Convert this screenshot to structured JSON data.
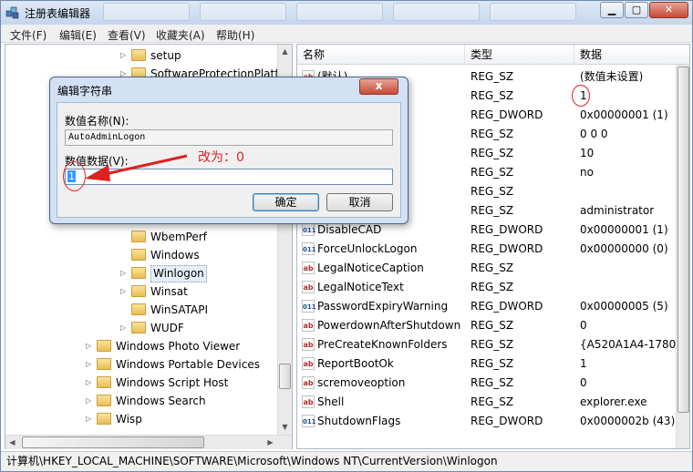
{
  "window": {
    "title": "注册表编辑器"
  },
  "menu": [
    "文件(F)",
    "编辑(E)",
    "查看(V)",
    "收藏夹(A)",
    "帮助(H)"
  ],
  "tree": {
    "items": [
      {
        "label": "setup",
        "expanded": false
      },
      {
        "label": "SoftwareProtectionPlatf",
        "expanded": false
      },
      {
        "label": "WbemPerf",
        "expanded": false
      },
      {
        "label": "Windows",
        "expanded": false
      },
      {
        "label": "Winlogon",
        "expanded": false,
        "selected": true
      },
      {
        "label": "Winsat",
        "expanded": false
      },
      {
        "label": "WinSATAPI",
        "expanded": false
      },
      {
        "label": "WUDF",
        "expanded": false
      },
      {
        "label": "Windows Photo Viewer",
        "expanded": false
      },
      {
        "label": "Windows Portable Devices",
        "expanded": false
      },
      {
        "label": "Windows Script Host",
        "expanded": false
      },
      {
        "label": "Windows Search",
        "expanded": false
      },
      {
        "label": "Wisp",
        "expanded": false
      }
    ]
  },
  "values": {
    "headers": {
      "name": "名称",
      "type": "类型",
      "data": "数据"
    },
    "rows": [
      {
        "name": "(默认)",
        "type": "REG_SZ",
        "data": "(数值未设置)",
        "kind": "sz"
      },
      {
        "name": "",
        "type": "REG_SZ",
        "data": "1",
        "kind": "sz"
      },
      {
        "name": "",
        "type": "REG_DWORD",
        "data": "0x00000001 (1)",
        "kind": "dword"
      },
      {
        "name": "",
        "type": "REG_SZ",
        "data": "0 0 0",
        "kind": "sz"
      },
      {
        "name": "unt",
        "type": "REG_SZ",
        "data": "10",
        "kind": "sz"
      },
      {
        "name": "mand",
        "type": "REG_SZ",
        "data": "no",
        "kind": "sz"
      },
      {
        "name": "",
        "type": "REG_SZ",
        "data": "",
        "kind": "sz"
      },
      {
        "name": "",
        "type": "REG_SZ",
        "data": "administrator",
        "kind": "sz"
      },
      {
        "name": "DisableCAD",
        "type": "REG_DWORD",
        "data": "0x00000001 (1)",
        "kind": "dword"
      },
      {
        "name": "ForceUnlockLogon",
        "type": "REG_DWORD",
        "data": "0x00000000 (0)",
        "kind": "dword"
      },
      {
        "name": "LegalNoticeCaption",
        "type": "REG_SZ",
        "data": "",
        "kind": "sz"
      },
      {
        "name": "LegalNoticeText",
        "type": "REG_SZ",
        "data": "",
        "kind": "sz"
      },
      {
        "name": "PasswordExpiryWarning",
        "type": "REG_DWORD",
        "data": "0x00000005 (5)",
        "kind": "dword"
      },
      {
        "name": "PowerdownAfterShutdown",
        "type": "REG_SZ",
        "data": "0",
        "kind": "sz"
      },
      {
        "name": "PreCreateKnownFolders",
        "type": "REG_SZ",
        "data": "{A520A1A4-1780-4",
        "kind": "sz"
      },
      {
        "name": "ReportBootOk",
        "type": "REG_SZ",
        "data": "1",
        "kind": "sz"
      },
      {
        "name": "scremoveoption",
        "type": "REG_SZ",
        "data": "0",
        "kind": "sz"
      },
      {
        "name": "Shell",
        "type": "REG_SZ",
        "data": "explorer.exe",
        "kind": "sz"
      },
      {
        "name": "ShutdownFlags",
        "type": "REG_DWORD",
        "data": "0x0000002b (43)",
        "kind": "dword"
      }
    ]
  },
  "status": {
    "path": "计算机\\HKEY_LOCAL_MACHINE\\SOFTWARE\\Microsoft\\Windows NT\\CurrentVersion\\Winlogon"
  },
  "dialog": {
    "title": "编辑字符串",
    "name_label": "数值名称(N):",
    "name_value": "AutoAdminLogon",
    "data_label": "数值数据(V):",
    "data_value": "1",
    "ok": "确定",
    "cancel": "取消",
    "close_glyph": "x"
  },
  "annotation": {
    "text": "改为：0",
    "color": "#e02020"
  },
  "colors": {
    "accent": "#3399ff",
    "folder": "#e9bd52",
    "annotation": "#e02020"
  },
  "icons": {
    "window_buttons": [
      "minimize-icon",
      "maximize-icon",
      "close-icon"
    ],
    "string_value": "ab",
    "dword_value": "011"
  }
}
